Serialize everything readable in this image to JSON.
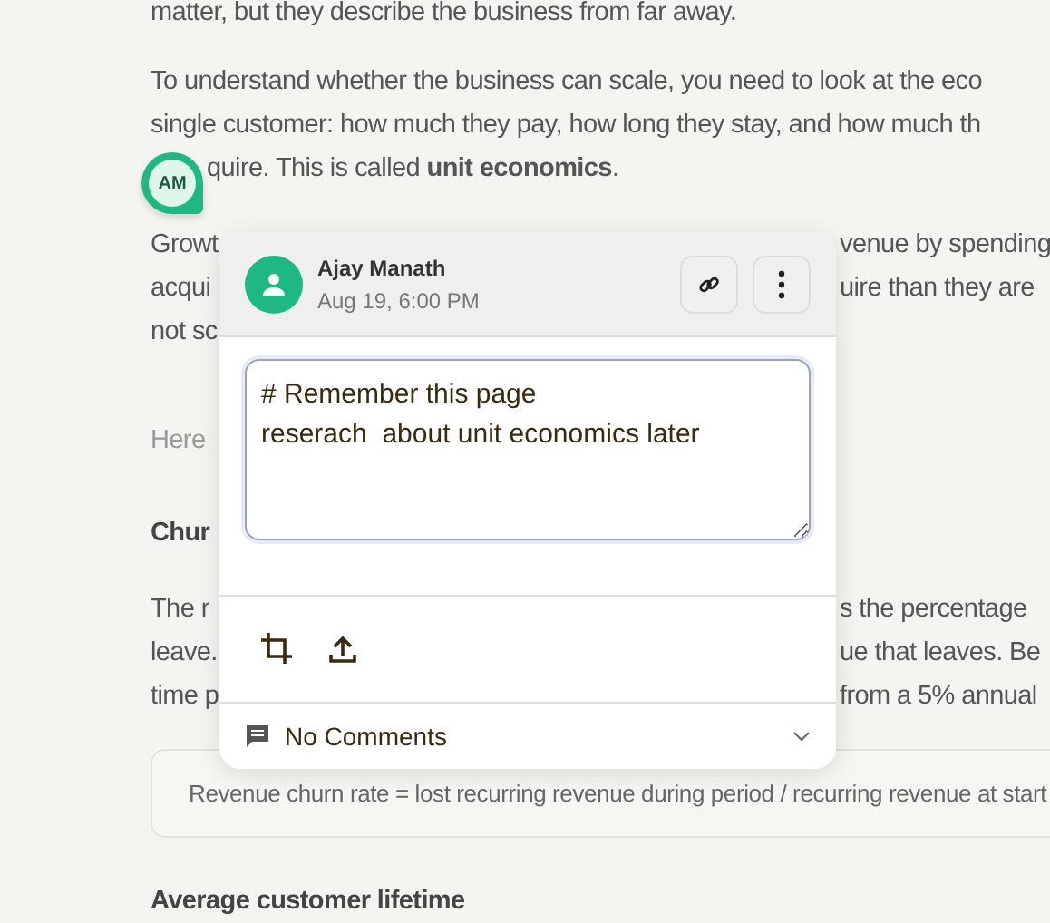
{
  "article": {
    "lines": [
      {
        "kind": "text",
        "left": "matter, but they describe the business from far away."
      },
      {
        "kind": "gap"
      },
      {
        "kind": "text",
        "left": "To understand whether the business can scale, you need to look at the eco"
      },
      {
        "kind": "text",
        "left": "single customer: how much they pay, how long they stay, and how much th"
      },
      {
        "kind": "text",
        "left": "quire. This is called **unit economics**.",
        "indent": true
      },
      {
        "kind": "gap"
      },
      {
        "kind": "text",
        "left": "Growt",
        "right": "venue by spending"
      },
      {
        "kind": "text",
        "left": "acqui",
        "right": "uire than they are"
      },
      {
        "kind": "text",
        "left": "not sc"
      },
      {
        "kind": "gap"
      },
      {
        "kind": "muted",
        "left": "Here"
      },
      {
        "kind": "gap"
      },
      {
        "kind": "heading",
        "left": "Chur"
      },
      {
        "kind": "gap"
      },
      {
        "kind": "text",
        "left": "The r",
        "right": "s the percentage"
      },
      {
        "kind": "text",
        "left": "leave.",
        "right": "ue that leaves. Be"
      },
      {
        "kind": "text",
        "left": "time p",
        "right": "from a 5% annual"
      },
      {
        "kind": "formula",
        "left": "Revenue churn rate = lost recurring revenue during period / recurring revenue at start"
      },
      {
        "kind": "heading",
        "left": "Average customer lifetime"
      }
    ]
  },
  "marker": {
    "initials": "AM"
  },
  "note": {
    "author": "Ajay Manath",
    "time": "Aug 19, 6:00 PM",
    "text": "# Remember this page\nreserach  about unit economics later",
    "comments": "No Comments",
    "expanded": false
  }
}
